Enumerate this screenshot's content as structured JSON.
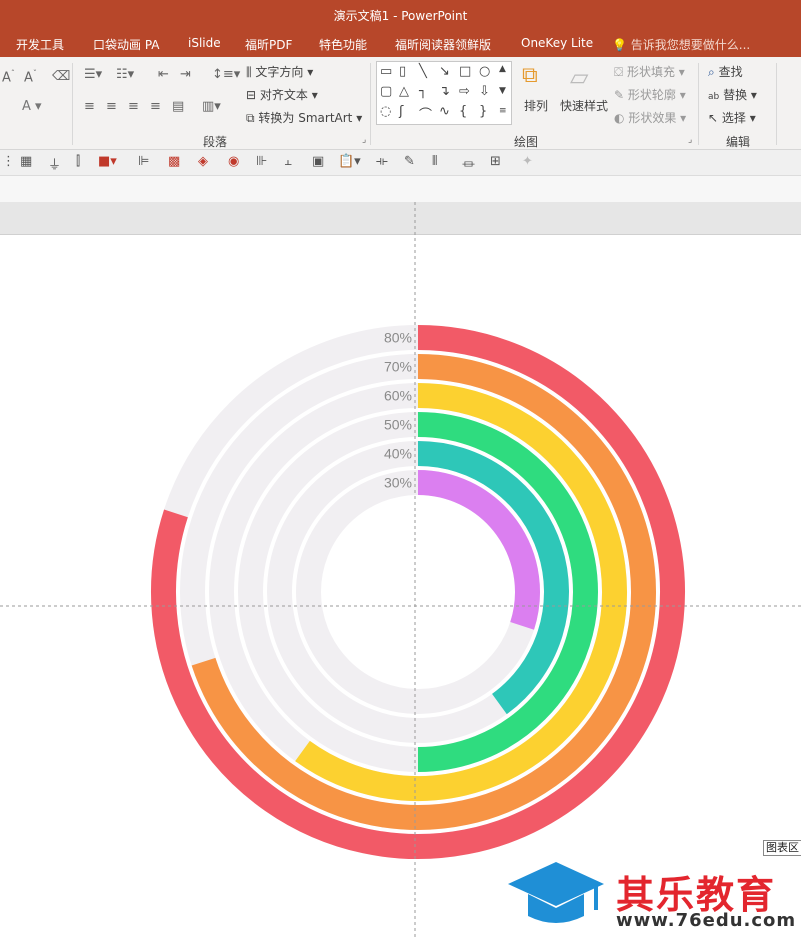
{
  "window": {
    "title": "演示文稿1 - PowerPoint"
  },
  "menu": {
    "tabs": [
      {
        "label": "开发工具"
      },
      {
        "label": "口袋动画 PA"
      },
      {
        "label": "iSlide"
      },
      {
        "label": "福昕PDF"
      },
      {
        "label": "特色功能"
      },
      {
        "label": "福昕阅读器领鲜版"
      },
      {
        "label": "OneKey Lite"
      }
    ],
    "tell_me": "告诉我您想要做什么..."
  },
  "ribbon": {
    "paragraph": {
      "label": "段落",
      "text_direction": "文字方向",
      "align_text": "对齐文本",
      "convert_smartart": "转换为 SmartArt"
    },
    "drawing": {
      "label": "绘图",
      "arrange": "排列",
      "quick_styles": "快速样式",
      "shape_fill": "形状填充",
      "shape_outline": "形状轮廓",
      "shape_effects": "形状效果"
    },
    "editing": {
      "label": "编辑",
      "find": "查找",
      "replace": "替换",
      "select": "选择"
    }
  },
  "slide": {
    "chart_area_tag": "图表区",
    "watermark": {
      "brand": "其乐教育",
      "url": "www.76edu.com"
    }
  },
  "chart_data": {
    "type": "radial-bar",
    "categories": [
      "80%",
      "70%",
      "60%",
      "50%",
      "40%",
      "30%"
    ],
    "values": [
      80,
      70,
      60,
      50,
      40,
      30
    ],
    "colors": [
      "#f25a67",
      "#f79445",
      "#fcd130",
      "#2fdc7f",
      "#2ec7b8",
      "#db7ff0"
    ],
    "track_color": "#f1eff2",
    "max": 100
  }
}
